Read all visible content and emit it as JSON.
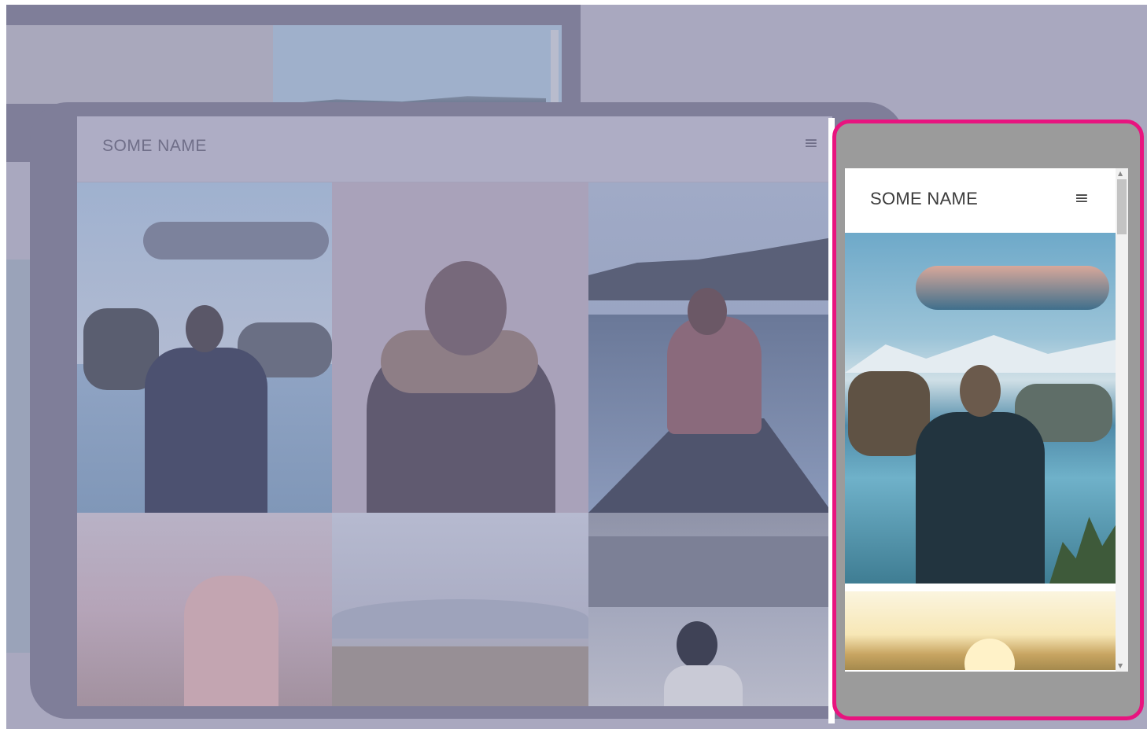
{
  "tablet": {
    "brand": "SOME NAME",
    "menu_icon": "≡"
  },
  "phone": {
    "brand": "SOME NAME",
    "menu_icon": "≡"
  },
  "colors": {
    "backdrop": "#a9a8bf",
    "device_frame": "#7f7e99",
    "highlight": "#e8147f",
    "phone_frame": "#9b9b9b"
  },
  "icons": {
    "tablet_menu": "hamburger-menu-icon",
    "phone_menu": "hamburger-menu-icon",
    "scroll_up": "scroll-up-arrow-icon",
    "scroll_down": "scroll-down-arrow-icon"
  }
}
